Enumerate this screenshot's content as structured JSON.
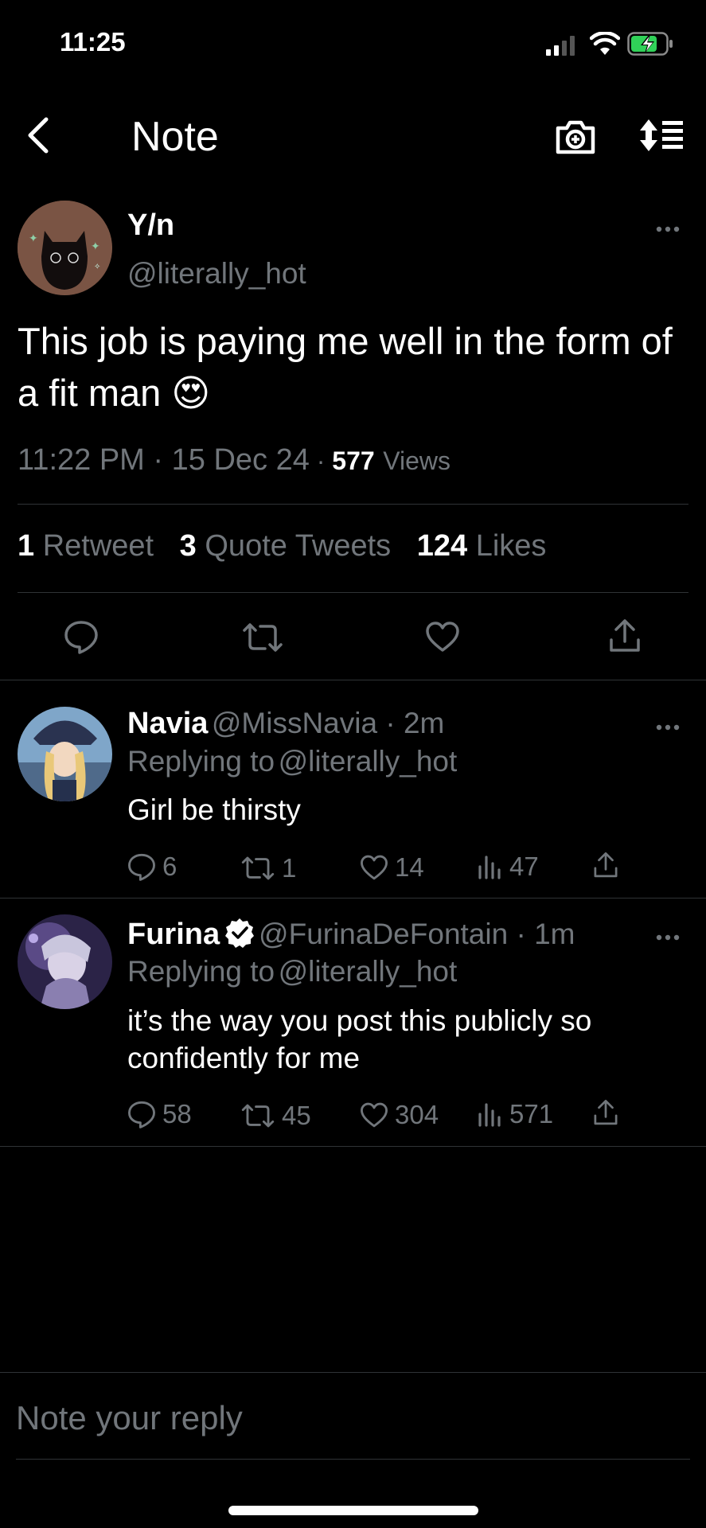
{
  "status_bar": {
    "time": "11:25"
  },
  "header": {
    "title": "Note"
  },
  "main_tweet": {
    "name": "Y/n",
    "handle": "@literally_hot",
    "text": "This job is paying me well in the form of a fit man 😍",
    "time": "11:22 PM",
    "date": "15 Dec 24",
    "views_count": "577",
    "views_label": "Views",
    "retweets_count": "1",
    "retweets_label": "Retweet",
    "quotes_count": "3",
    "quotes_label": "Quote Tweets",
    "likes_count": "124",
    "likes_label": "Likes"
  },
  "replies": [
    {
      "name": "Navia",
      "handle": "@MissNavia",
      "age": "2m",
      "replying_prefix": "Replying to",
      "replying_to": "@literally_hot",
      "text_lines": [
        "Girl be thirsty"
      ],
      "comments": "6",
      "retweets": "1",
      "likes": "14",
      "views": "47"
    },
    {
      "name": "Furina",
      "verified": true,
      "handle": "@FurinaDeFontain",
      "age": "1m",
      "replying_prefix": "Replying to",
      "replying_to": "@literally_hot",
      "text_lines": [
        "it’s the way you post this publicly so",
        "confidently for me"
      ],
      "comments": "58",
      "retweets": "45",
      "likes": "304",
      "views": "571"
    }
  ],
  "composer": {
    "placeholder": "Note your reply"
  },
  "colors": {
    "accent": "#1d9bf0",
    "muted": "#71767b",
    "background": "#000000",
    "battery": "#30d158"
  }
}
